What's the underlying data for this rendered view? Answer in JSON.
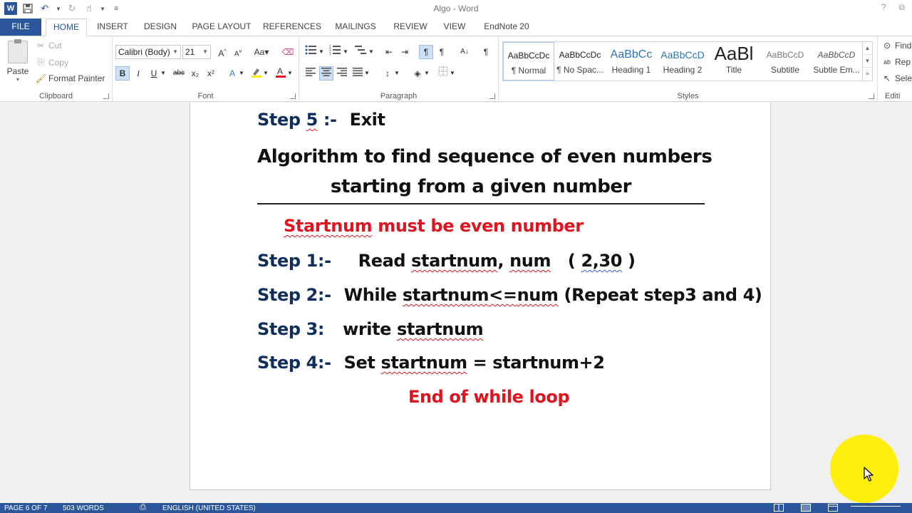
{
  "window": {
    "title": "Algo - Word",
    "help": "?",
    "restore": "⧉"
  },
  "tabs": {
    "file": "FILE",
    "home": "HOME",
    "insert": "INSERT",
    "design": "DESIGN",
    "page_layout": "PAGE LAYOUT",
    "references": "REFERENCES",
    "mailings": "MAILINGS",
    "review": "REVIEW",
    "view": "VIEW",
    "endnote": "EndNote 20"
  },
  "clipboard": {
    "paste": "Paste",
    "cut": "Cut",
    "copy": "Copy",
    "format_painter": "Format Painter",
    "label": "Clipboard"
  },
  "font": {
    "name": "Calibri (Body)",
    "size": "21",
    "label": "Font",
    "bold": "B",
    "italic": "I",
    "underline": "U",
    "strike": "abc",
    "subscript": "x₂",
    "superscript": "x²"
  },
  "paragraph": {
    "label": "Paragraph"
  },
  "styles": {
    "label": "Styles",
    "items": [
      {
        "preview": "AaBbCcDc",
        "name": "¶ Normal"
      },
      {
        "preview": "AaBbCcDc",
        "name": "¶ No Spac..."
      },
      {
        "preview": "AaBbCc",
        "name": "Heading 1"
      },
      {
        "preview": "AaBbCcD",
        "name": "Heading 2"
      },
      {
        "preview": "AaBl",
        "name": "Title"
      },
      {
        "preview": "AaBbCcD",
        "name": "Subtitle"
      },
      {
        "preview": "AaBbCcD",
        "name": "Subtle Em..."
      }
    ]
  },
  "editing": {
    "find": "Find",
    "replace": "Rep",
    "select": "Sele",
    "label": "Editi"
  },
  "document": {
    "step5_label": "Step ",
    "step5_num": "5",
    "step5_sep": " :-",
    "step5_text": "Exit",
    "heading_line1": "Algorithm to find sequence of even numbers",
    "heading_line2": "starting from a given number",
    "note": "Startnum",
    "note_rest": " must be even number",
    "step1_label": "Step 1:-",
    "step1_a": "Read ",
    "step1_b": "startnum",
    "step1_c": ", ",
    "step1_d": "num",
    "step1_e": "   ( ",
    "step1_f": "2,30",
    "step1_g": " )",
    "step2_label": "Step 2:-",
    "step2_a": "While ",
    "step2_b": "startnum",
    "step2_c": "<=",
    "step2_d": "num",
    "step2_e": " (Repeat step3 and 4)",
    "step3_label": "Step 3:",
    "step3_a": "write ",
    "step3_b": "startnum",
    "step4_label": "Step 4:-",
    "step4_a": "Set ",
    "step4_b": "startnum",
    "step4_c": " = startnum+2",
    "end_loop": "End of while loop"
  },
  "status": {
    "page": "PAGE 6 OF 7",
    "words": "503 WORDS",
    "language": "ENGLISH (UNITED STATES)"
  },
  "colors": {
    "word_blue": "#2b579a",
    "step_navy": "#0f2e5b",
    "alert_red": "#e0141e",
    "highlight_yellow": "#ffee00"
  }
}
